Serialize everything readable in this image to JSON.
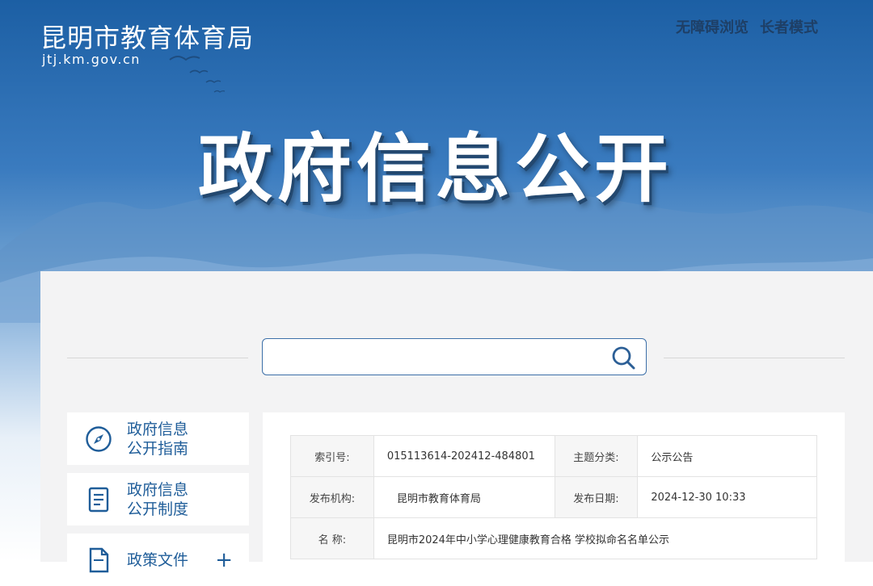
{
  "site": {
    "title": "昆明市教育体育局",
    "domain": "jtj.km.gov.cn"
  },
  "top_links": [
    {
      "label": "无障碍浏览"
    },
    {
      "label": "长者模式"
    }
  ],
  "banner": {
    "title": "政府信息公开"
  },
  "search": {
    "placeholder": "",
    "value": ""
  },
  "sidebar": {
    "items": [
      {
        "label": "政府信息\n公开指南",
        "icon": "compass-icon"
      },
      {
        "label": "政府信息\n公开制度",
        "icon": "document-icon"
      },
      {
        "label": "政策文件",
        "icon": "file-icon",
        "expand": "+"
      }
    ]
  },
  "info_table": {
    "rows": [
      {
        "l1": "索引号:",
        "v1": "015113614-202412-484801",
        "l2": "主题分类:",
        "v2": "公示公告"
      },
      {
        "l1": "发布机构:",
        "v1": "昆明市教育体育局",
        "l2": "发布日期:",
        "v2": "2024-12-30 10:33"
      },
      {
        "l1": "名 称:",
        "v1": "昆明市2024年中小学心理健康教育合格 学校拟命名名单公示"
      }
    ]
  },
  "colors": {
    "accent": "#1f5d99",
    "banner_top": "#1c5fa4",
    "search_border": "#3c6fa8"
  }
}
